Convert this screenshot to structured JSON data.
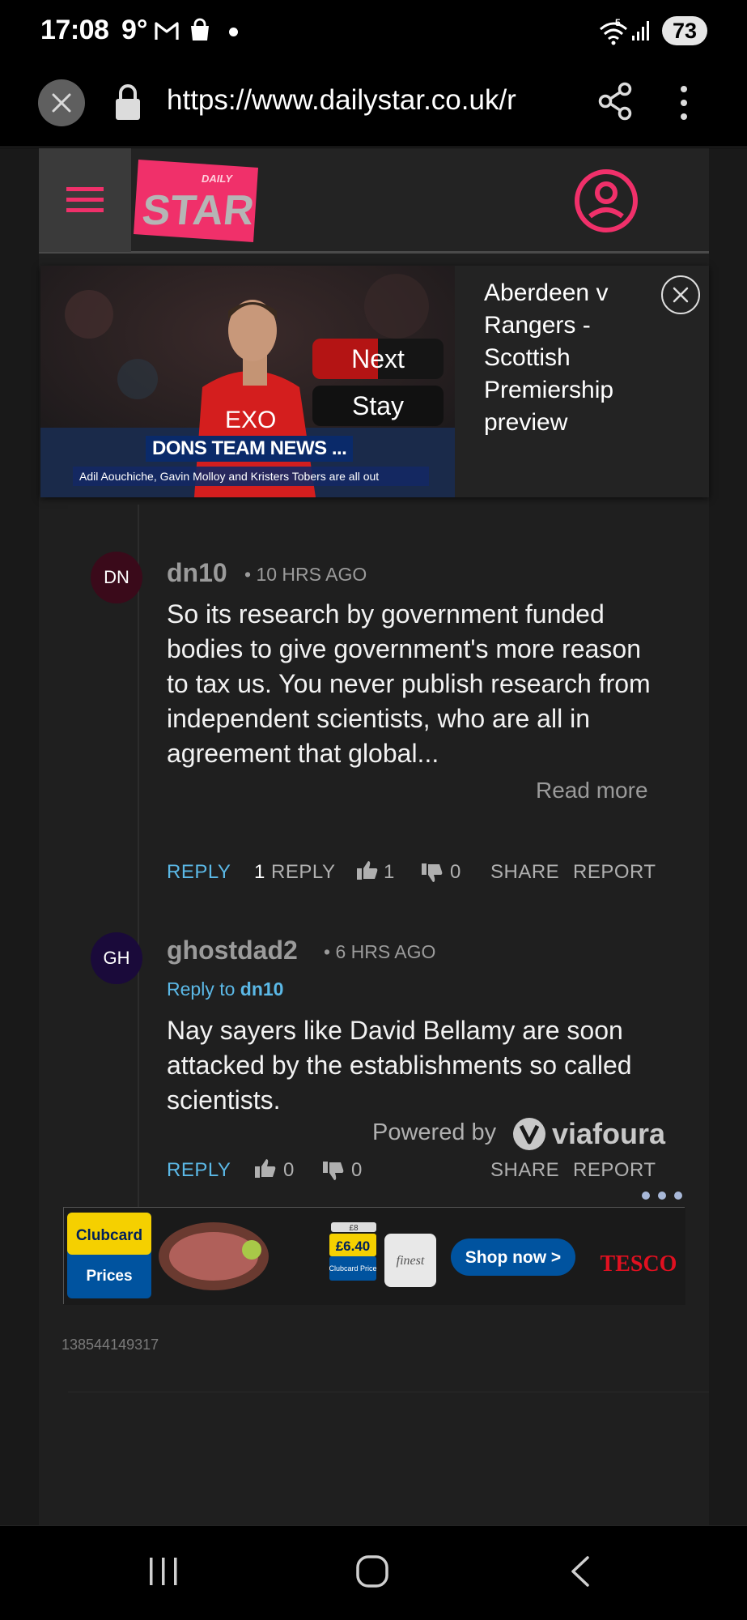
{
  "status_bar": {
    "time": "17:08",
    "temperature": "9°",
    "battery": "73",
    "wifi_badge": "5"
  },
  "browser": {
    "url": "https://www.dailystar.co.uk/r"
  },
  "header": {
    "logo_top": "DAILY",
    "logo_main": "STAR",
    "accent": "#f0306a"
  },
  "video": {
    "title": "Aberdeen v Rangers - Scottish Premiership preview",
    "next_label": "Next",
    "stay_label": "Stay",
    "thumb_headline": "DONS TEAM NEWS ...",
    "thumb_caption": "Adil Aouchiche, Gavin Molloy and Kristers Tobers are all out"
  },
  "comments": [
    {
      "avatar": "DN",
      "author": "dn10",
      "time": "• 10 HRS AGO",
      "body": "So its research by government funded bodies to give government's more reason to tax us. You never publish research from independent scientists, who are all in agreement that global...",
      "read_more": "Read more",
      "reply_label": "REPLY",
      "replies_count": "1",
      "replies_label": "REPLY",
      "likes": "1",
      "dislikes": "0",
      "share_label": "SHARE",
      "report_label": "REPORT"
    },
    {
      "avatar": "GH",
      "author": "ghostdad2",
      "time": "• 6 HRS AGO",
      "reply_to_label": "Reply to",
      "reply_to_user": "dn10",
      "body": "Nay sayers like David Bellamy are soon attacked by the establishments so called scientists.",
      "reply_label": "REPLY",
      "likes": "0",
      "dislikes": "0",
      "share_label": "SHARE",
      "report_label": "REPORT"
    }
  ],
  "footer": {
    "powered_by": "Powered by",
    "brand": "viafoura"
  },
  "ad": {
    "clubcard_top": "Clubcard",
    "clubcard_bottom": "Prices",
    "price_badge": "£8",
    "price": "£6.40",
    "price_label": "Clubcard Price",
    "finest": "finest",
    "cta": "Shop now >",
    "brand": "TESCO",
    "id": "138544149317"
  }
}
